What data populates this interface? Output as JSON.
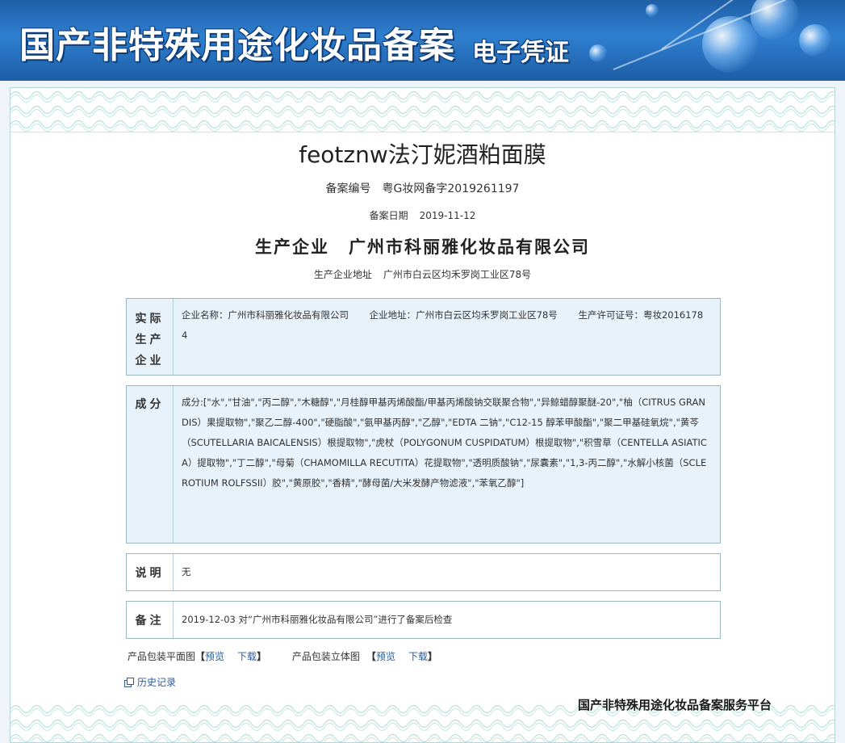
{
  "banner": {
    "title": "国产非特殊用途化妆品备案",
    "subtitle": "电子凭证"
  },
  "product": {
    "name": "feotznw法汀妮酒粕面膜",
    "record_no_label": "备案编号",
    "record_no": "粤G妆网备字2019261197",
    "record_date_label": "备案日期",
    "record_date": "2019-11-12",
    "producer_label": "生产企业",
    "producer": "广州市科丽雅化妆品有限公司",
    "producer_addr_label": "生产企业地址",
    "producer_addr": "广州市白云区均禾罗岗工业区78号"
  },
  "sections": {
    "manufacturer": {
      "label": [
        "实际",
        "生产",
        "企业"
      ],
      "name": "企业名称：广州市科丽雅化妆品有限公司",
      "address": "企业地址：广州市白云区均禾罗岗工业区78号",
      "license": "生产许可证号：粤妆20161784"
    },
    "ingredients": {
      "label": "成分",
      "text": "成分:[\"水\",\"甘油\",\"丙二醇\",\"木糖醇\",\"月桂醇甲基丙烯酸酯/甲基丙烯酸钠交联聚合物\",\"异鲸蜡醇聚醚-20\",\"柚（CITRUS GRANDIS）果提取物\",\"聚乙二醇-400\",\"硬脂酸\",\"氨甲基丙醇\",\"乙醇\",\"EDTA 二钠\",\"C12-15 醇苯甲酸酯\",\"聚二甲基硅氧烷\",\"黄芩（SCUTELLARIA BAICALENSIS）根提取物\",\"虎杖（POLYGONUM CUSPIDATUM）根提取物\",\"积雪草（CENTELLA ASIATICA）提取物\",\"丁二醇\",\"母菊（CHAMOMILLA RECUTITA）花提取物\",\"透明质酸钠\",\"尿囊素\",\"1,3-丙二醇\",\"水解小核菌（SCLEROTIUM ROLFSSII）胶\",\"黄原胶\",\"香精\",\"酵母菌/大米发酵产物滤液\",\"苯氧乙醇\"]"
    },
    "description": {
      "label": "说明",
      "text": "无"
    },
    "note": {
      "label": "备注",
      "text": "2019-12-03 对“广州市科丽雅化妆品有限公司”进行了备案后检查"
    }
  },
  "downloads": {
    "flat_label": "产品包装平面图",
    "solid_label": "产品包装立体图",
    "preview": "预览",
    "download": "下载",
    "open_bracket": "【",
    "close_bracket": "】"
  },
  "history": "历史记录",
  "platform": "国产非特殊用途化妆品备案服务平台",
  "colors": {
    "banner": "#2f7fd0",
    "box_blue": "#e7f2fa",
    "link": "#2a5c9a",
    "border": "#9bb8c6"
  }
}
